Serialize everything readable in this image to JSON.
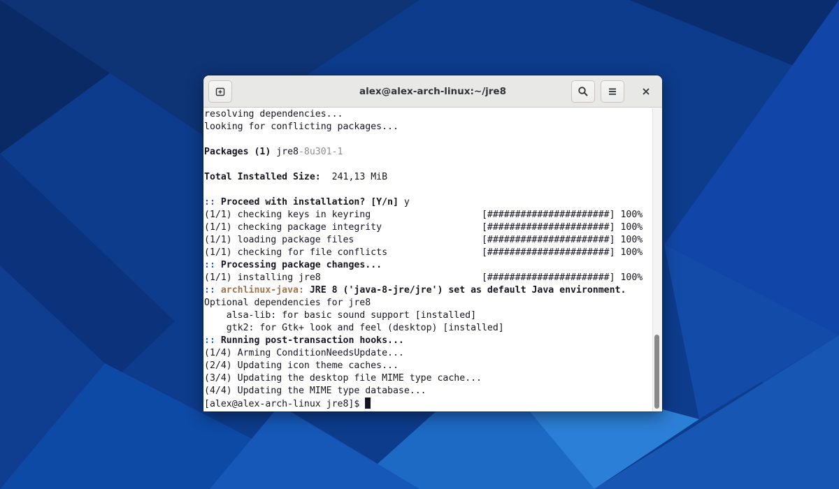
{
  "window": {
    "title": "alex@alex-arch-linux:~/jre8"
  },
  "icons": {
    "new_tab": "new-tab-icon",
    "search": "search-icon",
    "menu": "hamburger-menu-icon",
    "close": "close-icon"
  },
  "colors": {
    "prompt_marker": "#2a5db0",
    "package_version": "#8c8c8c",
    "hook_name": "#a2734c",
    "terminal_bg": "#ffffff",
    "terminal_fg": "#171421"
  },
  "terminal": {
    "lines": [
      "resolving dependencies...",
      "looking for conflicting packages...",
      "",
      "Packages (1) ",
      "",
      "Total Installed Size:  241,13 MiB",
      "",
      ":: ",
      "(1/1) checking keys in keyring                    [######################] 100%",
      "(1/1) checking package integrity                  [######################] 100%",
      "(1/1) loading package files                       [######################] 100%",
      "(1/1) checking for file conflicts                 [######################] 100%",
      ":: ",
      "(1/1) installing jre8                             [######################] 100%",
      ":: ",
      "Optional dependencies for jre8",
      "    alsa-lib: for basic sound support [installed]",
      "    gtk2: for Gtk+ look and feel (desktop) [installed]",
      ":: ",
      "(1/4) Arming ConditionNeedsUpdate...",
      "(2/4) Updating icon theme caches...",
      "(3/4) Updating the desktop file MIME type cache...",
      "(4/4) Updating the MIME type database...",
      "[alex@alex-arch-linux jre8]$ "
    ],
    "packages_label": "Packages (1) ",
    "package_name": "jre8",
    "package_version": "-8u301-1",
    "total_size_label": "Total Installed Size:  ",
    "total_size_value": "241,13 MiB",
    "prompt_marker": ":: ",
    "proceed_question": "Proceed with installation? [Y/n]",
    "proceed_answer": " y",
    "processing_changes": "Processing package changes...",
    "hook_name": "archlinux-java:",
    "hook_message": " JRE 8 ('java-8-jre/jre') set as default Java environment.",
    "running_hooks": "Running post-transaction hooks...",
    "shell_prompt": "[alex@alex-arch-linux jre8]$ "
  }
}
